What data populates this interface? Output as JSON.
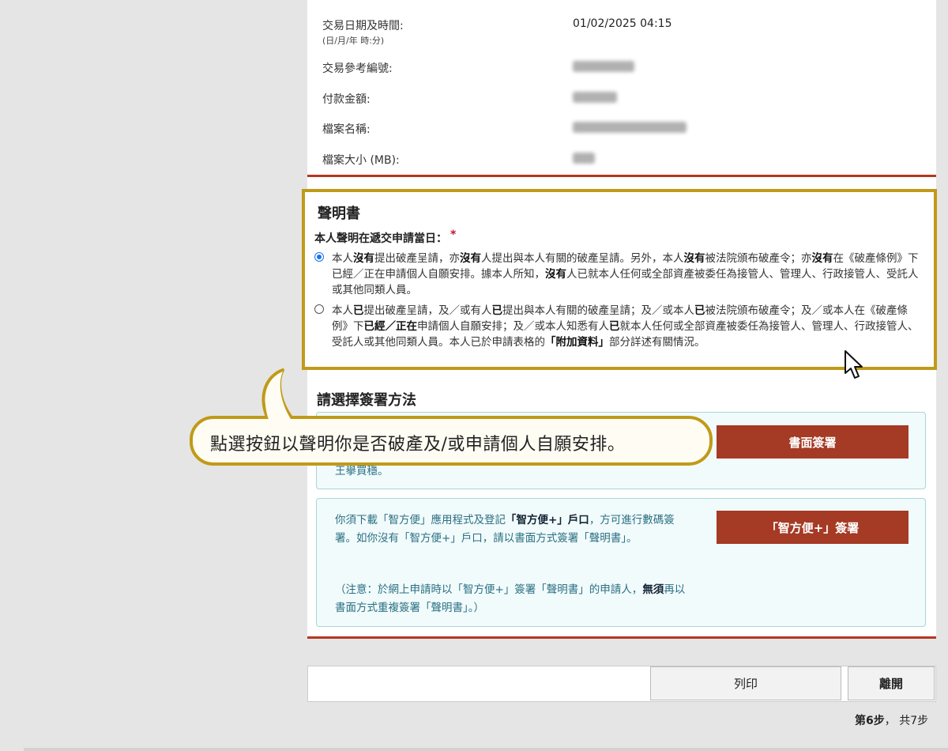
{
  "transaction": {
    "date_label": "交易日期及時間:",
    "date_format": "(日/月/年 時:分)",
    "date_value": "01/02/2025 04:15",
    "ref_label": "交易參考編號:",
    "amount_label": "付款金額:",
    "file_name_label": "檔案名稱:",
    "file_size_label": "檔案大小 (MB):"
  },
  "declaration": {
    "title": "聲明書",
    "question": "本人聲明在遞交申請當日：",
    "required_mark": "*",
    "option1": {
      "selected": true,
      "t1": "本人",
      "b1": "沒有",
      "t2": "提出破產呈請，亦",
      "b2": "沒有",
      "t3": "人提出與本人有關的破產呈請。另外，本人",
      "b3": "沒有",
      "t4": "被法院頒布破產令；亦",
      "b4": "沒有",
      "t5": "在《破產條例》下已經／正在申請個人自願安排。據本人所知，",
      "b5": "沒有",
      "t6": "人已就本人任何或全部資產被委任為接管人、管理人、行政接管人、受託人或其他同類人員。"
    },
    "option2": {
      "selected": false,
      "t1": "本人",
      "b1": "已",
      "t2": "提出破產呈請，及／或有人",
      "b2": "已",
      "t3": "提出與本人有關的破產呈請；及／或本人",
      "b3": "已",
      "t4": "被法院頒布破產令；及／或本人在《破產條例》下",
      "b4": "已經／正在",
      "t5": "申請個人自願安排；及／或本人知悉有人",
      "b5": "已",
      "t6": "就本人任何或全部資產被委任為接管人、管理人、行政接管人、受託人或其他同類人員。本人已於申請表格的",
      "b6": "「附加資料」",
      "t7": "部分詳述有關情況。"
    }
  },
  "signing": {
    "title": "請選擇簽署方法",
    "paper_fragment": "王擧買穩。",
    "paper_button": "書面簽署",
    "iam": {
      "p1": "你須下載「智方便」應用程式及登記",
      "p1_bold": "「智方便+」戶口",
      "p1_rest": "，方可進行數碼簽署。如你沒有「智方便+」戶口，請以書面方式簽署「聲明書」。",
      "note_start": "（注意：於網上申請時以「智方便+」簽署「聲明書」的申請人，",
      "note_bold": "無須",
      "note_end": "再以書面方式重複簽署「聲明書」。）",
      "button": "「智方便+」簽署"
    }
  },
  "actions": {
    "print": "列印",
    "leave": "離開"
  },
  "progress": {
    "current": "第6步",
    "separator": "，",
    "total": "共7步"
  },
  "callout": {
    "text": "點選按鈕以聲明你是否破產及/或申請個人自願安排。"
  },
  "colors": {
    "accent_border": "#c09a19",
    "divider": "#b5381f",
    "sign_button": "#a53a25",
    "info_text": "#2a6f83"
  }
}
